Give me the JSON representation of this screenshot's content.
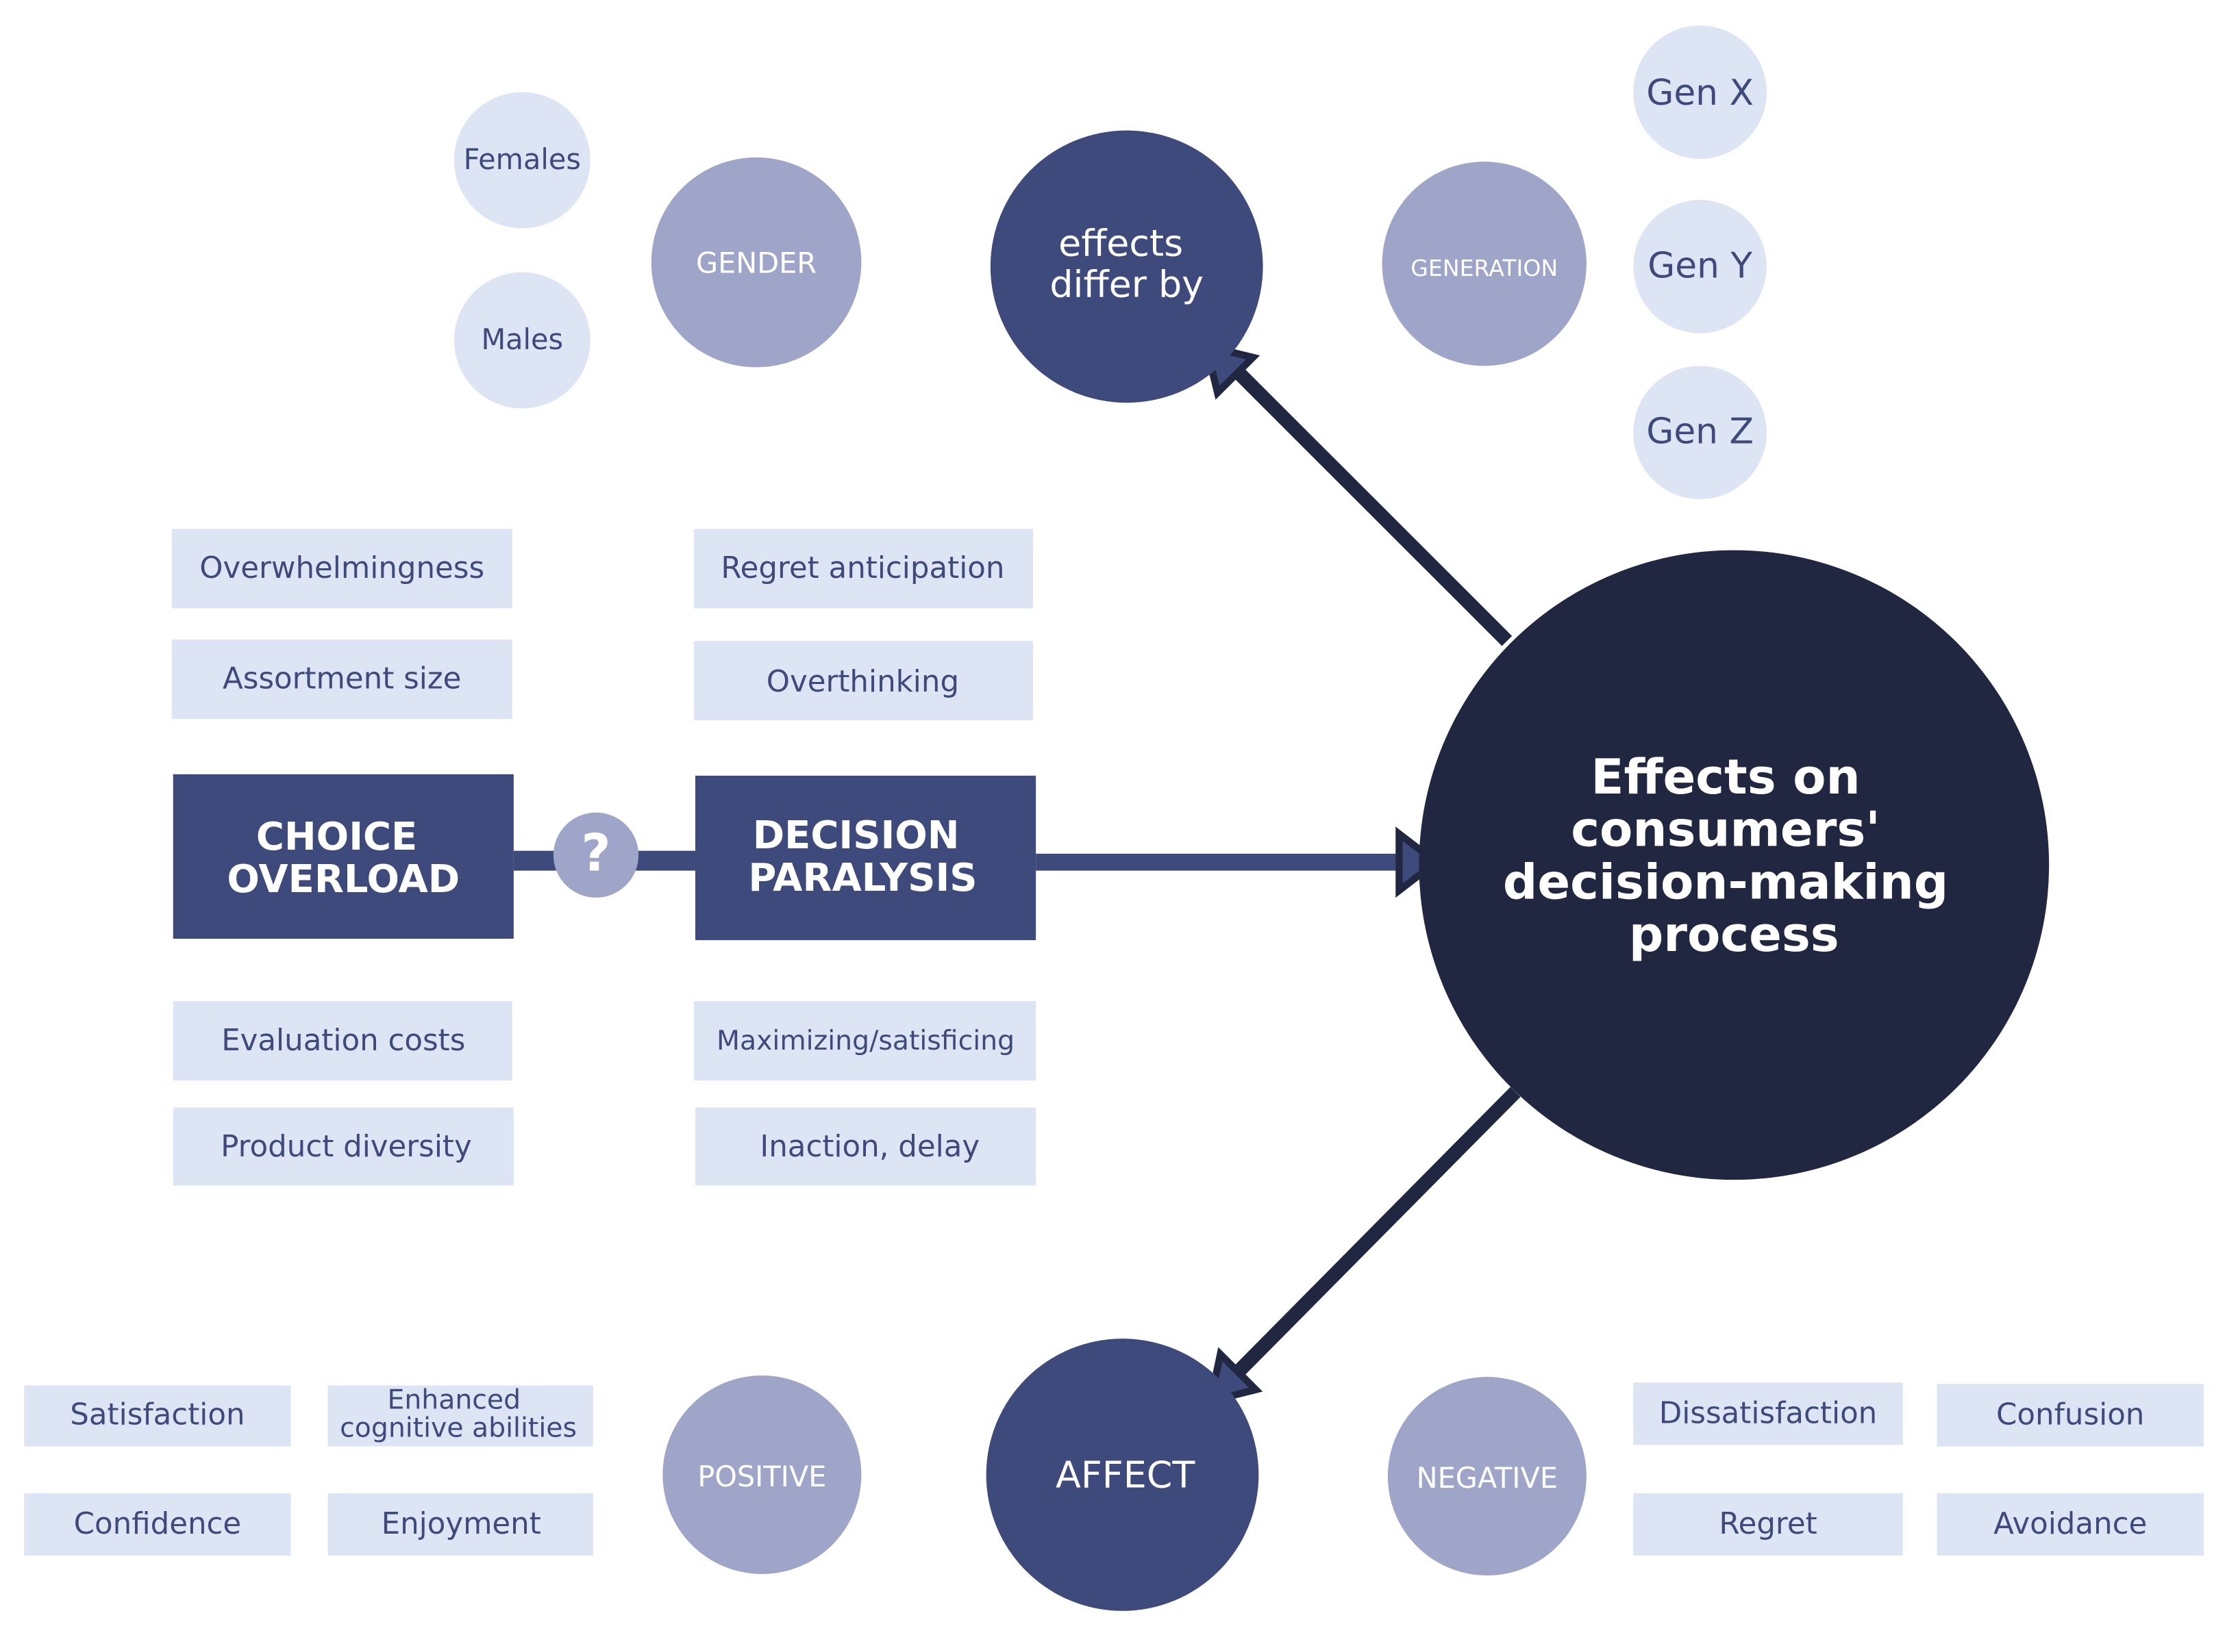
{
  "colors": {
    "dark": "#222741",
    "primary": "#3f4a7c",
    "secondary": "#9ea5c8",
    "light": "#dde4f3"
  },
  "center": {
    "lines": [
      "Effects on",
      "consumers'",
      "decision-making",
      "process"
    ]
  },
  "effects_differ": {
    "lines": [
      "effects",
      "differ by"
    ]
  },
  "gender": {
    "label": "GENDER",
    "items": [
      "Females",
      "Males"
    ]
  },
  "generation": {
    "label": "GENERATION",
    "items": [
      "Gen X",
      "Gen Y",
      "Gen Z"
    ]
  },
  "choice_overload": {
    "lines": [
      "CHOICE",
      "OVERLOAD"
    ],
    "above": [
      "Overwhelmingness",
      "Assortment size"
    ],
    "below": [
      "Evaluation costs",
      "Product diversity"
    ]
  },
  "question": {
    "icon": "question-mark-icon",
    "glyph": "?"
  },
  "decision_paralysis": {
    "lines": [
      "DECISION",
      "PARALYSIS"
    ],
    "above": [
      "Regret anticipation",
      "Overthinking"
    ],
    "below": [
      "Maximizing/satisficing",
      "Inaction, delay"
    ]
  },
  "affect": {
    "label": "AFFECT"
  },
  "positive": {
    "label": "POSITIVE",
    "items": [
      "Satisfaction",
      "Enhanced",
      "cognitive abilities",
      "Confidence",
      "Enjoyment"
    ]
  },
  "negative": {
    "label": "NEGATIVE",
    "items": [
      "Dissatisfaction",
      "Confusion",
      "Regret",
      "Avoidance"
    ]
  }
}
